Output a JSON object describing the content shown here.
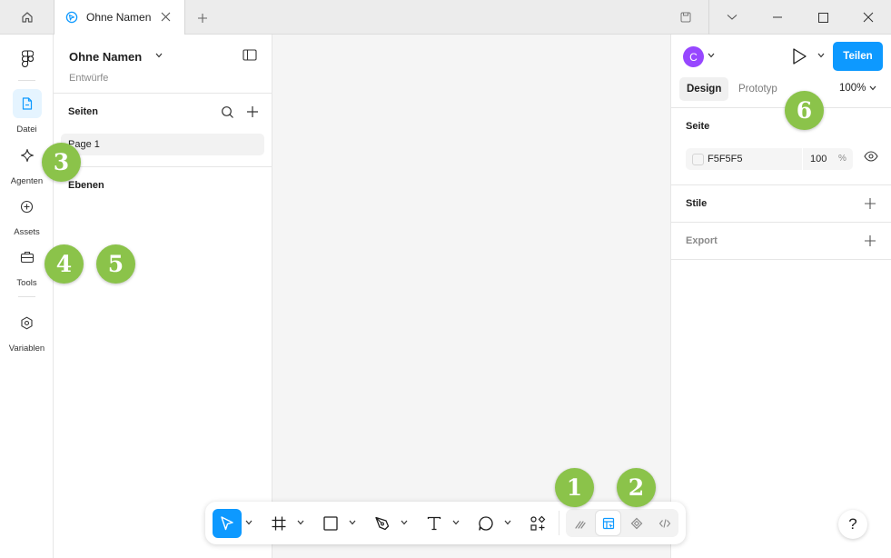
{
  "titlebar": {
    "tab_label": "Ohne Namen"
  },
  "rail": {
    "items": [
      {
        "label": "Datei",
        "icon": "file-icon",
        "active": true
      },
      {
        "label": "Agenten",
        "icon": "sparkle-icon"
      },
      {
        "label": "Assets",
        "icon": "assets-icon"
      },
      {
        "label": "Tools",
        "icon": "toolbox-icon"
      },
      {
        "label": "Variablen",
        "icon": "variables-icon"
      }
    ]
  },
  "left_panel": {
    "file_title": "Ohne Namen",
    "file_location": "Entwürfe",
    "pages_header": "Seiten",
    "pages": [
      "Page 1"
    ],
    "layers_header": "Ebenen"
  },
  "right_panel": {
    "avatar_initial": "C",
    "share_label": "Teilen",
    "tabs": [
      "Design",
      "Prototyp"
    ],
    "zoom": "100%",
    "page_section": "Seite",
    "fill_hex": "F5F5F5",
    "fill_opacity": "100",
    "fill_opacity_unit": "%",
    "styles_section": "Stile",
    "export_section": "Export"
  },
  "toolbar": {
    "tools": [
      "move-tool",
      "frame-tool",
      "rectangle-tool",
      "pen-tool",
      "text-tool",
      "comment-tool",
      "actions-tool"
    ],
    "modes": [
      "draw-mode",
      "design-mode",
      "dev-mode",
      "code-mode"
    ]
  },
  "help_label": "?",
  "colors": {
    "accent": "#0d99ff",
    "avatar": "#9747ff",
    "badge": "#8bc34a"
  },
  "annotations": [
    "1",
    "2",
    "3",
    "4",
    "5",
    "6"
  ]
}
